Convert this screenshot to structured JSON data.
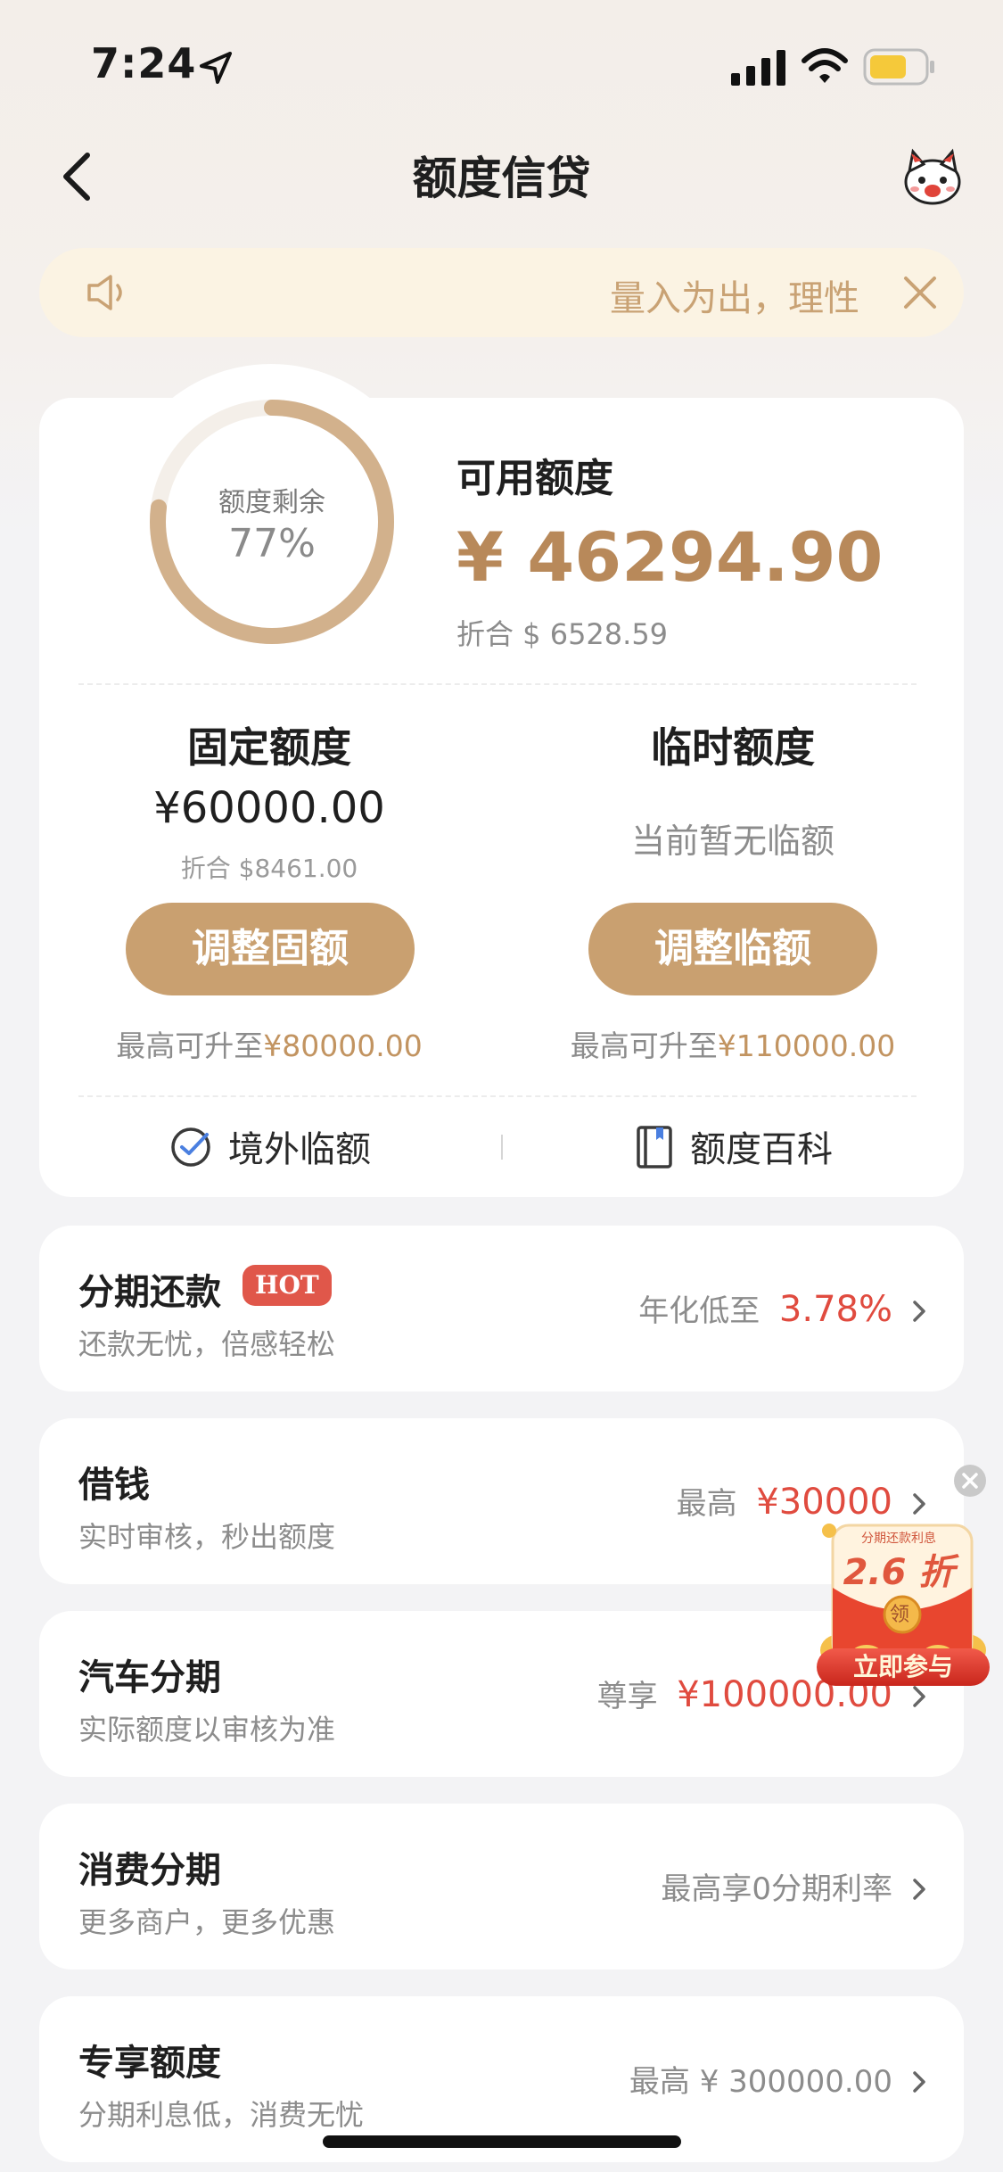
{
  "status_bar": {
    "time": "7:24"
  },
  "nav": {
    "title": "额度信贷"
  },
  "notice": {
    "text": "量入为出，理性"
  },
  "quota": {
    "ring_label": "额度剩余",
    "ring_percent_text": "77%",
    "ring_fraction": 0.77,
    "available_title": "可用额度",
    "available_amount": "¥ 46294.90",
    "available_converted": "折合 $ 6528.59",
    "fixed": {
      "title": "固定额度",
      "amount": "¥60000.00",
      "converted": "折合 $8461.00",
      "button": "调整固额",
      "max_prefix": "最高可升至",
      "max_value": "¥80000.00"
    },
    "temporary": {
      "title": "临时额度",
      "status": "当前暂无临额",
      "button": "调整临额",
      "max_prefix": "最高可升至",
      "max_value": "¥110000.00"
    },
    "links": {
      "overseas": "境外临额",
      "encyclopedia": "额度百科"
    }
  },
  "services": [
    {
      "title": "分期还款",
      "badge": "HOT",
      "subtitle": "还款无忧，倍感轻松",
      "right_prefix": "年化低至",
      "right_value": "3.78%"
    },
    {
      "title": "借钱",
      "subtitle": "实时审核，秒出额度",
      "right_prefix": "最高",
      "right_value": "¥30000"
    },
    {
      "title": "汽车分期",
      "subtitle": "实际额度以审核为准",
      "right_prefix": "尊享",
      "right_value": "¥100000.00"
    },
    {
      "title": "消费分期",
      "subtitle": "更多商户，更多优惠",
      "right_prefix": "最高享0分期利率",
      "right_value": ""
    },
    {
      "title": "专享额度",
      "subtitle": "分期利息低，消费无忧",
      "right_prefix": "最高 ¥ 300000.00",
      "right_value": ""
    }
  ],
  "promo": {
    "header": "分期还款利息",
    "rate": "2.6 折",
    "claim": "领",
    "cta": "立即参与"
  },
  "colors": {
    "gold": "#c9a070",
    "gold_text": "#b8895a",
    "red": "#e04b3f",
    "notice_bg": "#fbf3e3"
  }
}
